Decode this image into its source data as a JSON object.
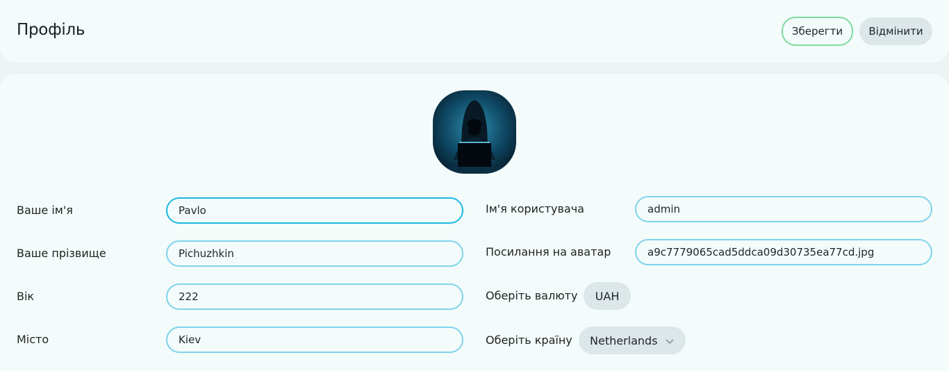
{
  "header": {
    "title": "Профіль",
    "save_label": "Зберегти",
    "cancel_label": "Відмінити"
  },
  "form": {
    "first_name": {
      "label": "Ваше ім'я",
      "value": "Pavlo"
    },
    "last_name": {
      "label": "Ваше прізвище",
      "value": "Pichuzhkin"
    },
    "age": {
      "label": "Вік",
      "value": "222"
    },
    "city": {
      "label": "Місто",
      "value": "Kiev"
    },
    "username": {
      "label": "Ім'я користувача",
      "value": "admin"
    },
    "avatar_link": {
      "label": "Посилання на аватар",
      "value": "a9c7779065cad5ddca09d30735ea77cd.jpg"
    },
    "currency": {
      "label": "Оберіть валюту",
      "value": "UAH"
    },
    "country": {
      "label": "Оберіть країну",
      "value": "Netherlands"
    }
  },
  "icons": {
    "avatar": "hooded-hacker-image",
    "country_dropdown": "chevron-down-icon"
  },
  "colors": {
    "background": "#ebf3f3",
    "card": "#f3fbfb",
    "input_border": "#7fd3ea",
    "input_focus_border": "#1ab8e0",
    "save_border": "#7fd9a0",
    "chip_bg": "#dde7ea"
  }
}
